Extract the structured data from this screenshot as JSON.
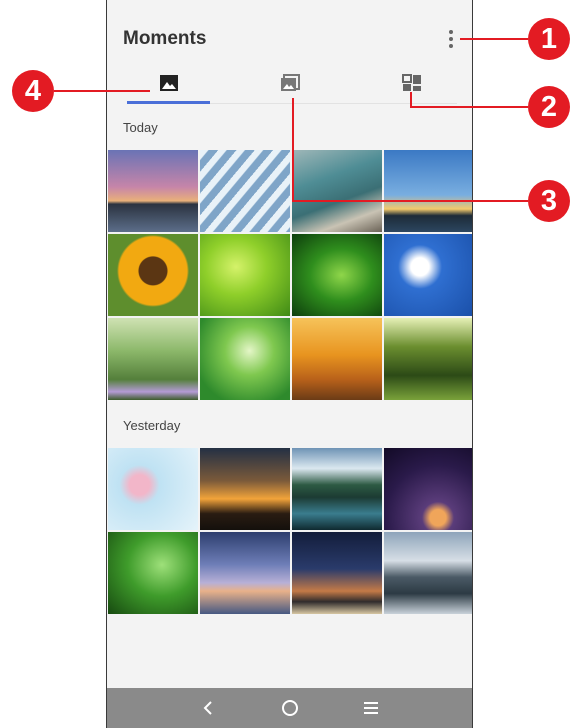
{
  "header": {
    "title": "Moments"
  },
  "tabs": [
    {
      "icon": "photo-icon",
      "selected": true
    },
    {
      "icon": "album-icon",
      "selected": false
    },
    {
      "icon": "collage-icon",
      "selected": false
    }
  ],
  "sections": [
    {
      "label": "Today",
      "photos": [
        "sunset-lake",
        "wispy-clouds",
        "rocky-coast",
        "sunset-sky",
        "sunflower",
        "green-leaves",
        "water-drops-leaf",
        "dandelion",
        "wildflowers",
        "leaf-droplets",
        "autumn-forest",
        "green-forest"
      ]
    },
    {
      "label": "Yesterday",
      "photos": [
        "pink-flower",
        "cloud-sunset",
        "mountain-lake",
        "planet-space",
        "leaf-raindrops",
        "evening-beach",
        "night-road",
        "rocky-shore"
      ]
    }
  ],
  "callouts": [
    "1",
    "2",
    "3",
    "4"
  ],
  "colors": {
    "accent": "#4a6fd8",
    "callout": "#e31b23",
    "navbar": "#8a8a8a"
  }
}
